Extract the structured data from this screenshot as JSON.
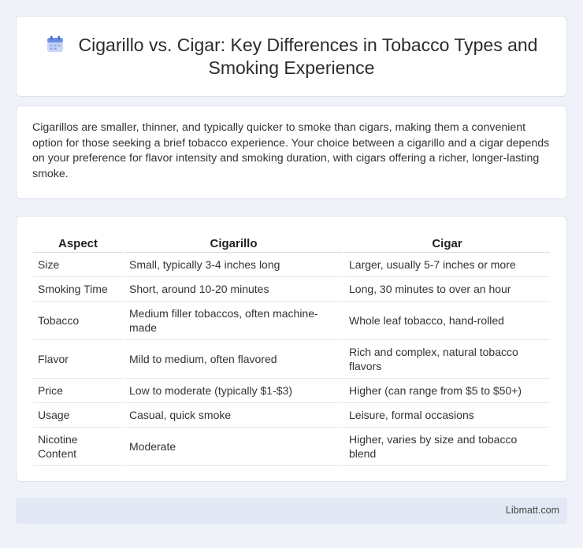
{
  "header": {
    "icon": "calendar-icon",
    "title": "Cigarillo vs. Cigar: Key Differences in Tobacco Types and Smoking Experience"
  },
  "intro": {
    "text": "Cigarillos are smaller, thinner, and typically quicker to smoke than cigars, making them a convenient option for those seeking a brief tobacco experience. Your choice between a cigarillo and a cigar depends on your preference for flavor intensity and smoking duration, with cigars offering a richer, longer-lasting smoke."
  },
  "table": {
    "headers": [
      "Aspect",
      "Cigarillo",
      "Cigar"
    ],
    "rows": [
      [
        "Size",
        "Small, typically 3-4 inches long",
        "Larger, usually 5-7 inches or more"
      ],
      [
        "Smoking Time",
        "Short, around 10-20 minutes",
        "Long, 30 minutes to over an hour"
      ],
      [
        "Tobacco",
        "Medium filler tobaccos, often machine-made",
        "Whole leaf tobacco, hand-rolled"
      ],
      [
        "Flavor",
        "Mild to medium, often flavored",
        "Rich and complex, natural tobacco flavors"
      ],
      [
        "Price",
        "Low to moderate (typically $1-$3)",
        "Higher (can range from $5 to $50+)"
      ],
      [
        "Usage",
        "Casual, quick smoke",
        "Leisure, formal occasions"
      ],
      [
        "Nicotine Content",
        "Moderate",
        "Higher, varies by size and tobacco blend"
      ]
    ]
  },
  "footer": {
    "source": "Libmatt.com"
  },
  "colors": {
    "background": "#eff3f9",
    "card": "#ffffff",
    "footer": "#e3e9f4",
    "icon_accent": "#6b8de3"
  }
}
